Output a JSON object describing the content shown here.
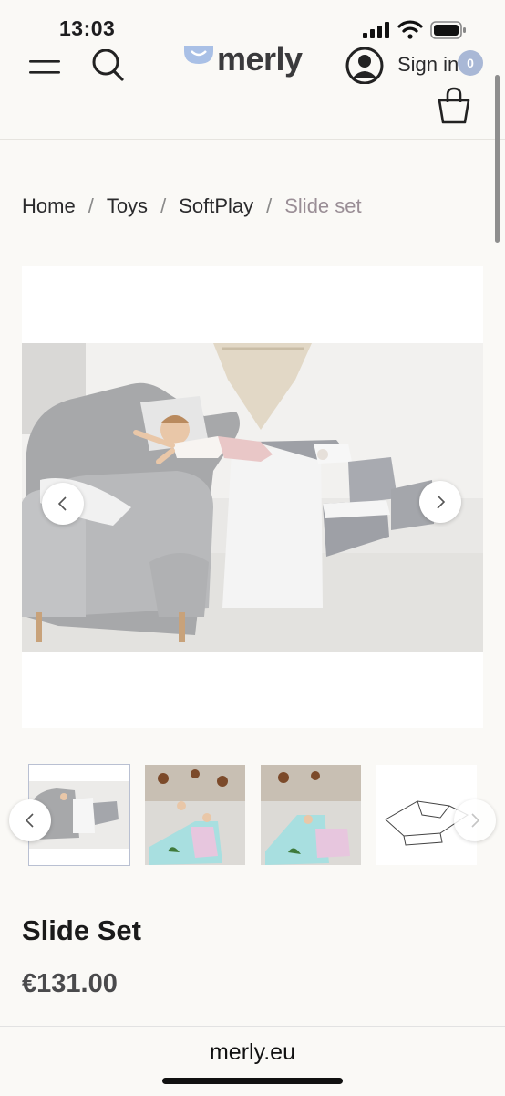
{
  "status_bar": {
    "time": "13:03",
    "icons": [
      "cellular-signal-icon",
      "wifi-icon",
      "battery-icon"
    ]
  },
  "header": {
    "logo_text": "merly",
    "sign_in_label": "Sign in",
    "cart_count": "0",
    "icons": [
      "menu-icon",
      "search-icon",
      "account-icon",
      "cart-icon"
    ]
  },
  "breadcrumb": {
    "items": [
      "Home",
      "Toys",
      "SoftPlay",
      "Slide set"
    ],
    "separator": "/"
  },
  "gallery": {
    "prev_icon": "chevron-left-icon",
    "next_icon": "chevron-right-icon",
    "thumbnail_count": 4,
    "active_thumbnail": 1
  },
  "product": {
    "title": "Slide Set",
    "price": "€131.00"
  },
  "browser": {
    "url": "merly.eu"
  },
  "colors": {
    "background": "#faf9f6",
    "badge": "#a9b8d6",
    "breadcrumb_current": "#9a8e96",
    "price": "#4a4a4c"
  }
}
